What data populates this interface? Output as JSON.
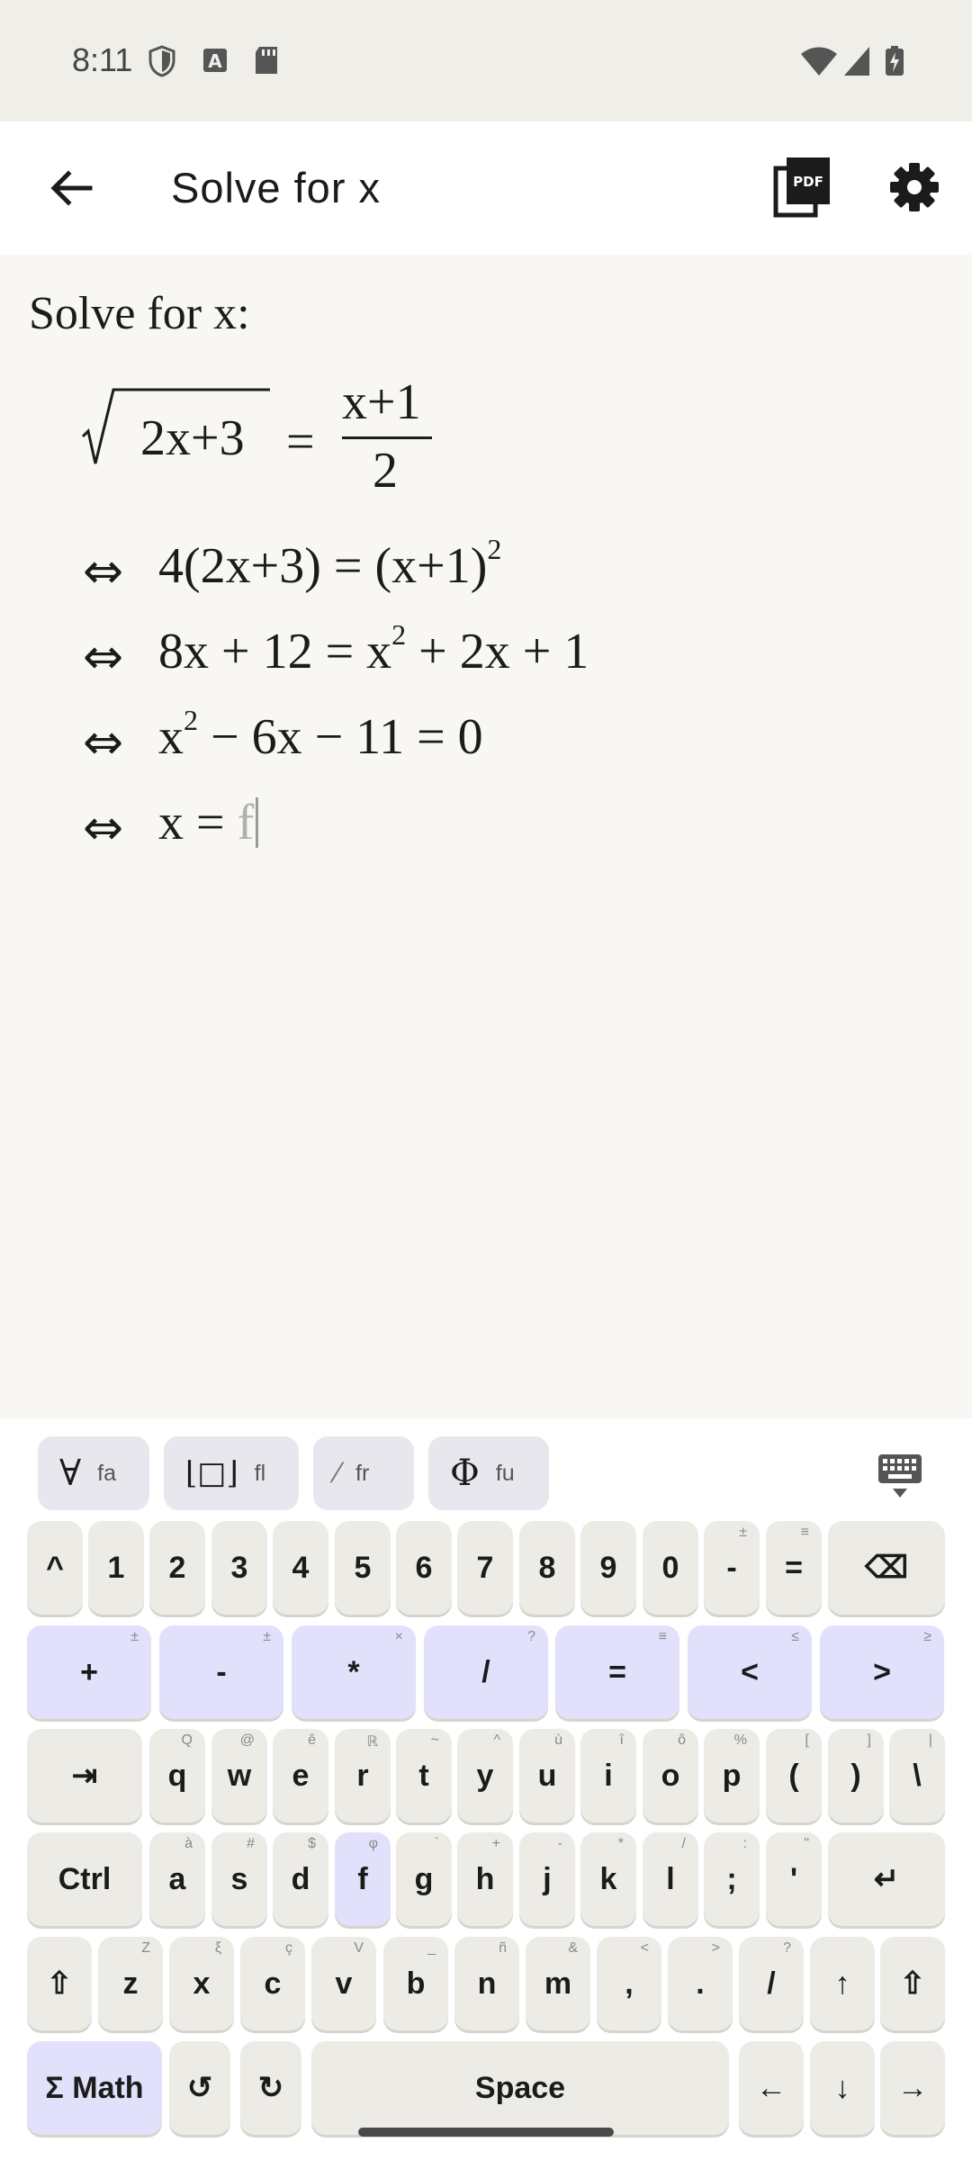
{
  "status": {
    "time": "8:11"
  },
  "app_bar": {
    "title": "Solve for x"
  },
  "math": {
    "prompt": "Solve for x:",
    "line1": {
      "radicand": "2x+3",
      "equals": "=",
      "numerator": "x+1",
      "denominator": "2"
    },
    "line2": {
      "iff": "⇔",
      "lhs": "4(2x+3) = (x+1)",
      "exp": "2"
    },
    "line3": {
      "iff": "⇔",
      "pre": "8x + 12 = x",
      "exp": "2",
      "post": " + 2x + 1"
    },
    "line4": {
      "iff": "⇔",
      "pre": "x",
      "exp": "2",
      "post": " − 6x − 11 = 0"
    },
    "line5": {
      "iff": "⇔",
      "text": "x = ",
      "typed": "f"
    }
  },
  "suggestions": [
    {
      "symbol": "∀",
      "label": "fa"
    },
    {
      "symbol": "⌊□⌋",
      "label": "fl"
    },
    {
      "symbol": "⁄",
      "label": "fr"
    },
    {
      "symbol": "Φ",
      "label": "fu"
    }
  ],
  "keys": {
    "row1": [
      {
        "main": "^",
        "hint": ""
      },
      {
        "main": "1",
        "hint": ""
      },
      {
        "main": "2",
        "hint": ""
      },
      {
        "main": "3",
        "hint": ""
      },
      {
        "main": "4",
        "hint": ""
      },
      {
        "main": "5",
        "hint": ""
      },
      {
        "main": "6",
        "hint": ""
      },
      {
        "main": "7",
        "hint": ""
      },
      {
        "main": "8",
        "hint": ""
      },
      {
        "main": "9",
        "hint": ""
      },
      {
        "main": "0",
        "hint": ""
      },
      {
        "main": "-",
        "hint": "±"
      },
      {
        "main": "=",
        "hint": "≡"
      },
      {
        "main": "⌫",
        "hint": ""
      }
    ],
    "row2": [
      {
        "main": "+",
        "hint": "±"
      },
      {
        "main": "-",
        "hint": "±"
      },
      {
        "main": "*",
        "hint": "×"
      },
      {
        "main": "/",
        "hint": "?"
      },
      {
        "main": "=",
        "hint": "≡"
      },
      {
        "main": "<",
        "hint": "≤"
      },
      {
        "main": ">",
        "hint": "≥"
      }
    ],
    "row3": [
      {
        "main": "⇥",
        "hint": ""
      },
      {
        "main": "q",
        "hint": "Q"
      },
      {
        "main": "w",
        "hint": "@"
      },
      {
        "main": "e",
        "hint": "ê"
      },
      {
        "main": "r",
        "hint": "ℝ"
      },
      {
        "main": "t",
        "hint": "~"
      },
      {
        "main": "y",
        "hint": "^"
      },
      {
        "main": "u",
        "hint": "ù"
      },
      {
        "main": "i",
        "hint": "î"
      },
      {
        "main": "o",
        "hint": "ô"
      },
      {
        "main": "p",
        "hint": "%"
      },
      {
        "main": "(",
        "hint": "["
      },
      {
        "main": ")",
        "hint": "]"
      },
      {
        "main": "\\",
        "hint": "|"
      }
    ],
    "row4": [
      {
        "main": "Ctrl",
        "hint": ""
      },
      {
        "main": "a",
        "hint": "à"
      },
      {
        "main": "s",
        "hint": "#"
      },
      {
        "main": "d",
        "hint": "$"
      },
      {
        "main": "f",
        "hint": "φ"
      },
      {
        "main": "g",
        "hint": "`"
      },
      {
        "main": "h",
        "hint": "+"
      },
      {
        "main": "j",
        "hint": "-"
      },
      {
        "main": "k",
        "hint": "*"
      },
      {
        "main": "l",
        "hint": "/"
      },
      {
        "main": ";",
        "hint": ":"
      },
      {
        "main": "'",
        "hint": "\""
      },
      {
        "main": "↵",
        "hint": ""
      }
    ],
    "row5": [
      {
        "main": "⇧",
        "hint": ""
      },
      {
        "main": "z",
        "hint": "Z"
      },
      {
        "main": "x",
        "hint": "ξ"
      },
      {
        "main": "c",
        "hint": "ç"
      },
      {
        "main": "v",
        "hint": "V"
      },
      {
        "main": "b",
        "hint": "_"
      },
      {
        "main": "n",
        "hint": "ñ"
      },
      {
        "main": "m",
        "hint": "&"
      },
      {
        "main": ",",
        "hint": "<"
      },
      {
        "main": ".",
        "hint": ">"
      },
      {
        "main": "/",
        "hint": "?"
      },
      {
        "main": "↑",
        "hint": ""
      },
      {
        "main": "⇧",
        "hint": ""
      }
    ],
    "row6": [
      {
        "main": "Σ Math",
        "hint": ""
      },
      {
        "main": "↺",
        "hint": ""
      },
      {
        "main": "↻",
        "hint": ""
      },
      {
        "main": "Space",
        "hint": ""
      },
      {
        "main": "←",
        "hint": ""
      },
      {
        "main": "↓",
        "hint": ""
      },
      {
        "main": "→",
        "hint": ""
      }
    ]
  },
  "colors": {
    "accent_key": "#e1e1fb",
    "key": "#ecebe5",
    "background": "#f8f7f3"
  }
}
